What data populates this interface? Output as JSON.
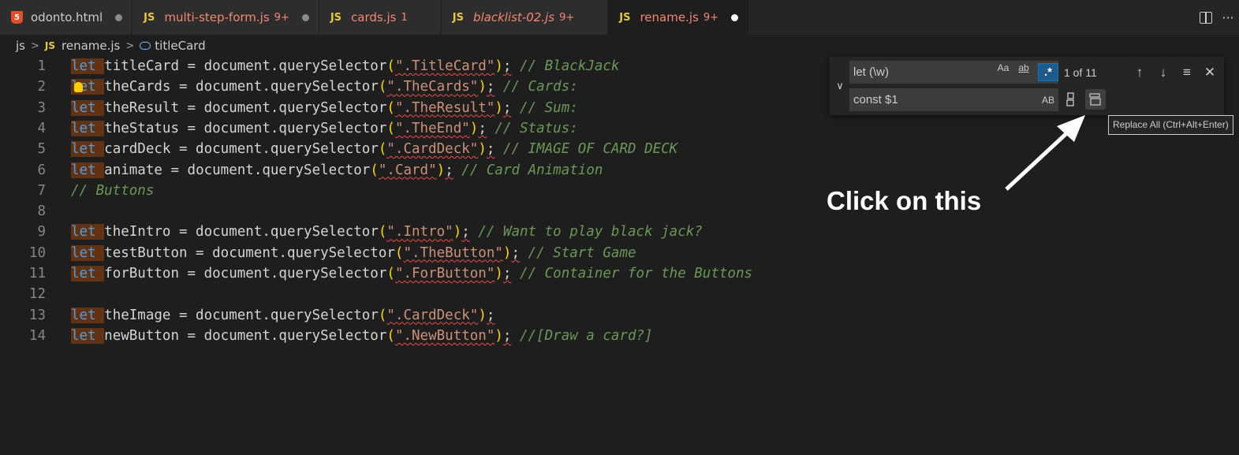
{
  "tabs": [
    {
      "icon": "html5-icon",
      "label": "odonto.html",
      "badge": "",
      "state": "plain"
    },
    {
      "icon": "js-icon",
      "label": "multi-step-form.js",
      "badge": "9+",
      "state": "err"
    },
    {
      "icon": "js-icon",
      "label": "cards.js",
      "badge": "1",
      "state": "err"
    },
    {
      "icon": "js-icon",
      "label": "blacklist-02.js",
      "badge": "9+",
      "state": "err-italic"
    },
    {
      "icon": "js-icon",
      "label": "rename.js",
      "badge": "9+",
      "state": "active"
    }
  ],
  "tab_icon_text": {
    "js": "JS",
    "html5": "5"
  },
  "breadcrumb": {
    "folder": "js",
    "file": "rename.js",
    "symbol": "titleCard"
  },
  "code_lines": [
    {
      "num": "1",
      "kw": "let",
      "ident": "titleCard",
      "mid": " = document.querySelector",
      "str": "\".TitleCard\"",
      "cmt": "// BlackJack"
    },
    {
      "num": "2",
      "kw": "let",
      "ident": "theCards",
      "mid": " = document.querySelector",
      "str": "\".TheCards\"",
      "cmt": "// Cards:"
    },
    {
      "num": "3",
      "kw": "let",
      "ident": "theResult",
      "mid": " = document.querySelector",
      "str": "\".TheResult\"",
      "cmt": "// Sum:"
    },
    {
      "num": "4",
      "kw": "let",
      "ident": "theStatus",
      "mid": " = document.querySelector",
      "str": "\".TheEnd\"",
      "cmt": "// Status:"
    },
    {
      "num": "5",
      "kw": "let",
      "ident": "cardDeck",
      "mid": " = document.querySelector",
      "str": "\".CardDeck\"",
      "cmt": "// IMAGE OF CARD DECK"
    },
    {
      "num": "6",
      "kw": "let",
      "ident": "animate",
      "mid": " = document.querySelector",
      "str": "\".Card\"",
      "cmt": "// Card Animation"
    },
    {
      "num": "7",
      "kw": "",
      "ident": "",
      "mid": "",
      "str": "",
      "cmt": "// Buttons"
    },
    {
      "num": "8",
      "kw": "",
      "ident": "",
      "mid": "",
      "str": "",
      "cmt": ""
    },
    {
      "num": "9",
      "kw": "let",
      "ident": "theIntro",
      "mid": " = document.querySelector",
      "str": "\".Intro\"",
      "cmt": "// Want to play black jack?"
    },
    {
      "num": "10",
      "kw": "let",
      "ident": "testButton",
      "mid": " = document.querySelector",
      "str": "\".TheButton\"",
      "cmt": "// Start Game"
    },
    {
      "num": "11",
      "kw": "let",
      "ident": "forButton",
      "mid": " = document.querySelector",
      "str": "\".ForButton\"",
      "cmt": "// Container for the Buttons"
    },
    {
      "num": "12",
      "kw": "",
      "ident": "",
      "mid": "",
      "str": "",
      "cmt": ""
    },
    {
      "num": "13",
      "kw": "let",
      "ident": "theImage",
      "mid": " = document.querySelector",
      "str": "\".CardDeck\"",
      "cmt": ""
    },
    {
      "num": "14",
      "kw": "let",
      "ident": "newButton",
      "mid": " = document.querySelector",
      "str": "\".NewButton\"",
      "cmt": "//[Draw a card?]"
    }
  ],
  "find_widget": {
    "find_value": "let (\\w)",
    "replace_value": "const $1",
    "match_case_label": "Aa",
    "whole_word_label": "ab",
    "regex_label": ".*",
    "preserve_case_label": "AB",
    "match_count": "1 of 11"
  },
  "tooltip": "Replace All (Ctrl+Alt+Enter)",
  "annotation": "Click on this",
  "colors": {
    "keyword": "#569cd6",
    "string": "#ce9178",
    "comment": "#6a9955",
    "match_highlight": "#613214",
    "error": "#f48771"
  }
}
